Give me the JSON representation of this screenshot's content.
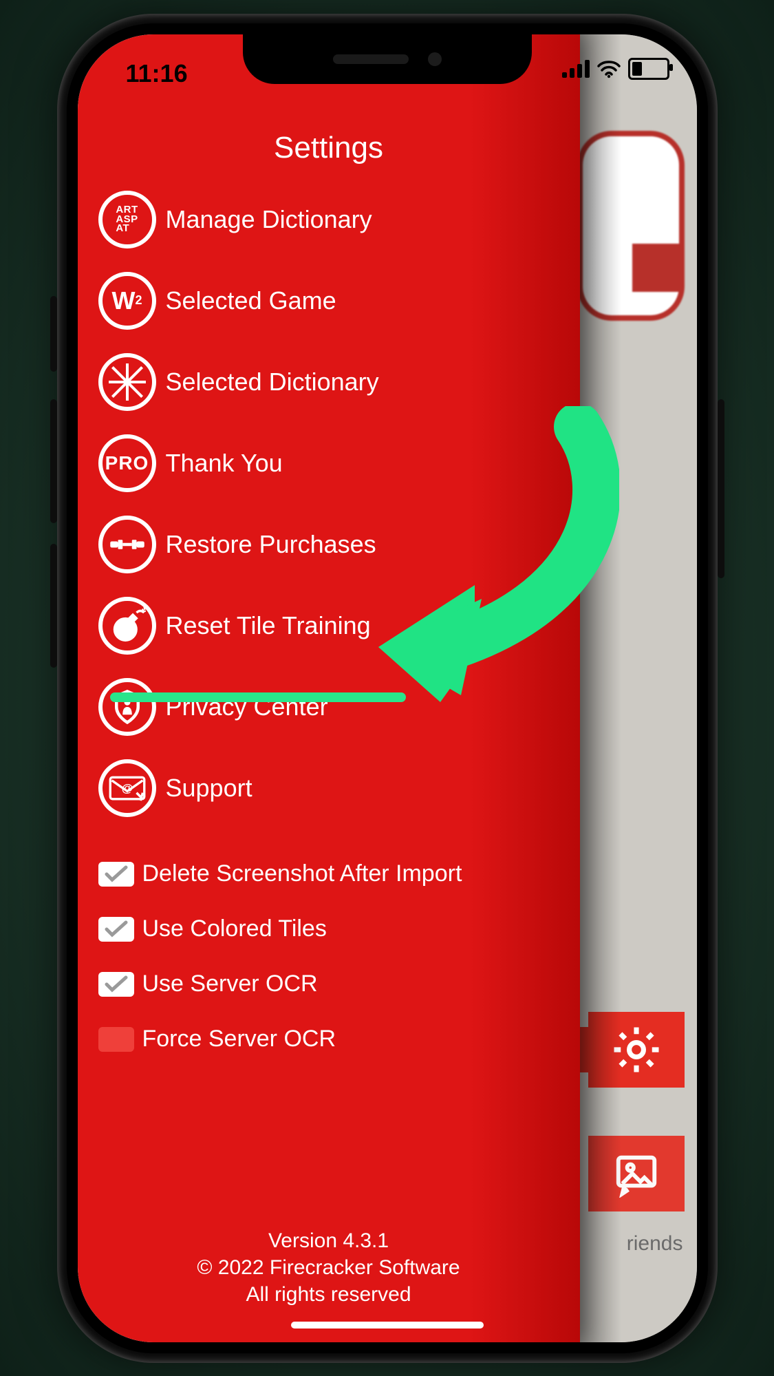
{
  "status": {
    "time": "11:16"
  },
  "panel_title": "Settings",
  "items": [
    {
      "label": "Manage Dictionary"
    },
    {
      "label": "Selected Game"
    },
    {
      "label": "Selected Dictionary"
    },
    {
      "label": "Thank You"
    },
    {
      "label": "Restore Purchases"
    },
    {
      "label": "Reset Tile Training"
    },
    {
      "label": "Privacy Center"
    },
    {
      "label": "Support"
    }
  ],
  "checks": [
    {
      "label": "Delete Screenshot After Import",
      "checked": true
    },
    {
      "label": "Use Colored Tiles",
      "checked": true
    },
    {
      "label": "Use Server OCR",
      "checked": true
    },
    {
      "label": "Force Server OCR",
      "checked": false
    }
  ],
  "footer": {
    "version": "Version 4.3.1",
    "copyright": "© 2022 Firecracker Software",
    "rights": "All rights reserved"
  },
  "bg_strip": {
    "friends_hint": "riends"
  },
  "highlighted_item_index": 5,
  "colors": {
    "panel_red": "#de1515",
    "accent_green": "#29e58b"
  }
}
